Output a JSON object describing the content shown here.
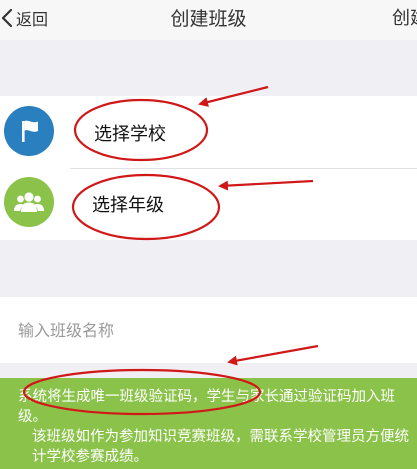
{
  "navbar": {
    "back_label": "返回",
    "title": "创建班级",
    "right_action_label": "创建"
  },
  "rows": [
    {
      "label": "选择学校",
      "icon": "flag-icon",
      "icon_color": "#2a7fbf"
    },
    {
      "label": "选择年级",
      "icon": "people-icon",
      "icon_color": "#8bc34a"
    }
  ],
  "class_name_input": {
    "placeholder": "输入班级名称",
    "value": ""
  },
  "notice": {
    "paragraph_1": "系统将生成唯一班级验证码，学生与家长通过验证码加入班级。",
    "paragraph_2": "该班级如作为参加知识竞赛班级，需联系学校管理员方便统计学校参赛成绩。"
  },
  "colors": {
    "annotation": "#d01818",
    "notice_bg": "#8bc34a",
    "page_bg": "#efeff4"
  }
}
